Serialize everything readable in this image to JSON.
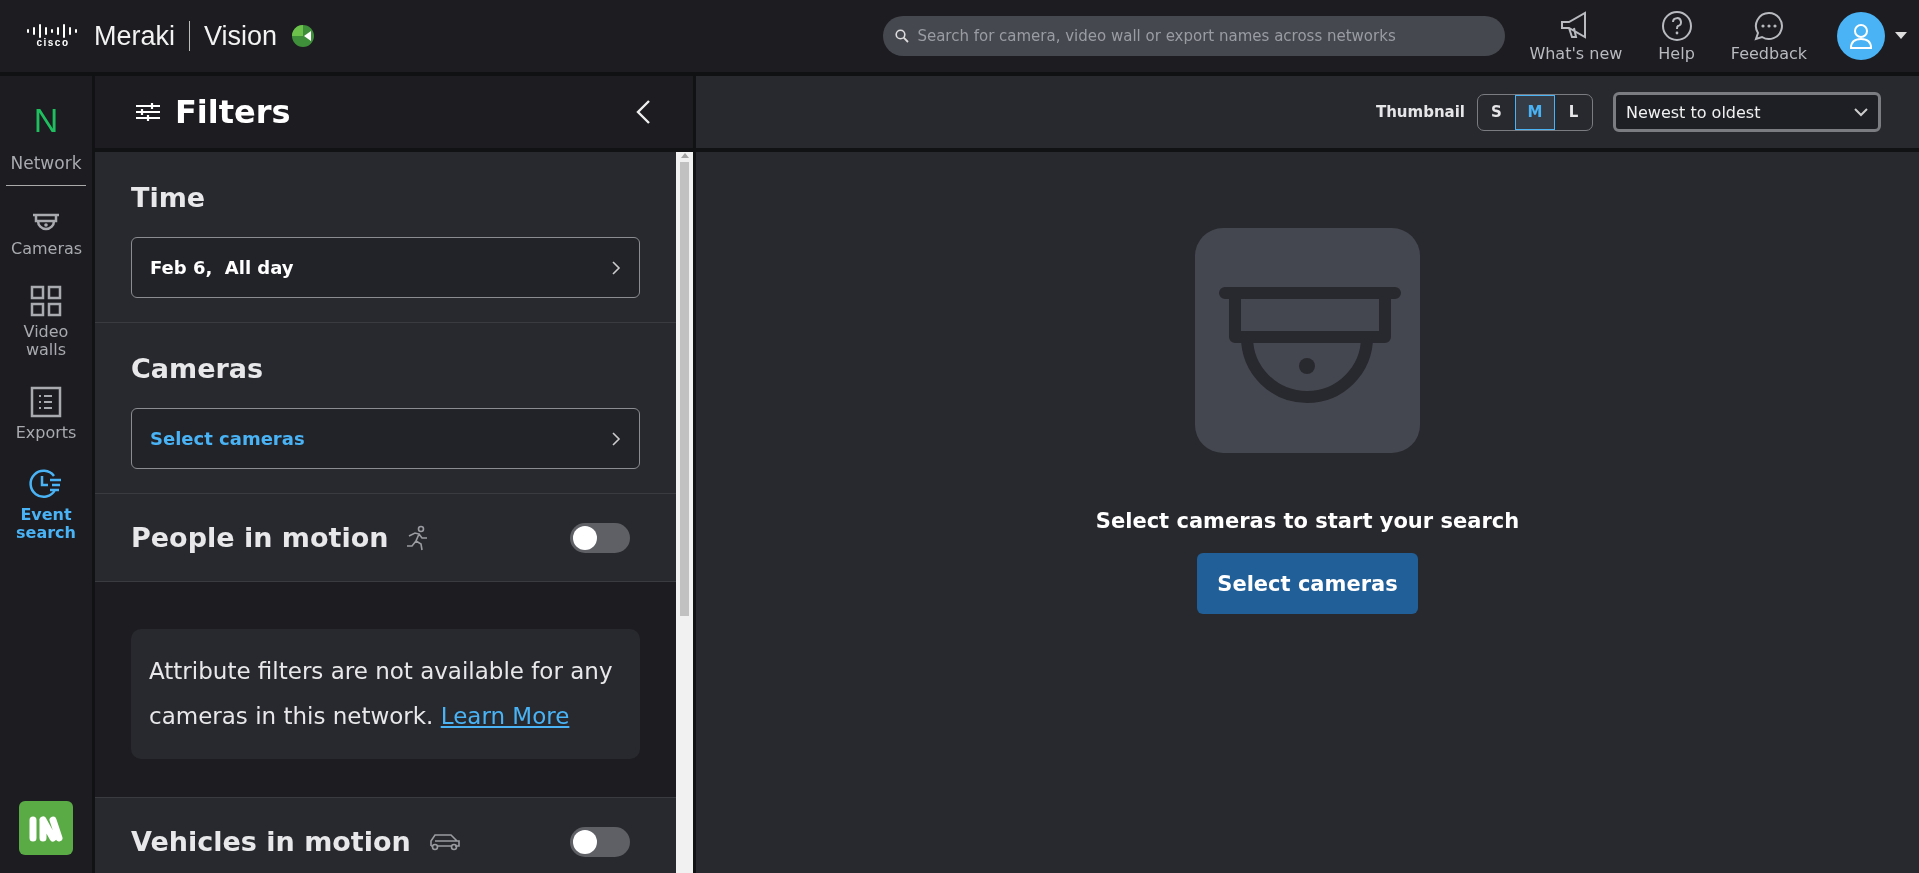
{
  "header": {
    "brand": "cisco",
    "product": "Meraki",
    "app": "Vision",
    "search": {
      "placeholder": "Search for camera, video wall or export names across networks"
    },
    "actions": [
      {
        "kind": "megaphone",
        "label": "What's new"
      },
      {
        "kind": "help",
        "label": "Help"
      },
      {
        "kind": "chat",
        "label": "Feedback"
      }
    ]
  },
  "nav": {
    "network": {
      "initial": "N",
      "label": "Network"
    },
    "items": [
      {
        "kind": "camera",
        "label": "Cameras",
        "selected": false
      },
      {
        "kind": "grid",
        "label": "Video walls",
        "selected": false
      },
      {
        "kind": "list",
        "label": "Exports",
        "selected": false
      },
      {
        "kind": "clock",
        "label": "Event search",
        "selected": true
      }
    ]
  },
  "filters": {
    "title": "Filters",
    "sections": [
      {
        "kind": "picker",
        "heading": "Time",
        "value": "Feb 6,  All day",
        "filled": true
      },
      {
        "kind": "picker",
        "heading": "Cameras",
        "value": "Select cameras",
        "filled": false
      },
      {
        "kind": "people",
        "heading": "People in motion",
        "on": false
      },
      {
        "kind": "notice",
        "text": "Attribute filters are not available for any cameras in this network.",
        "link": "Learn More"
      },
      {
        "kind": "vehicles",
        "heading": "Vehicles in motion",
        "on": false
      }
    ]
  },
  "toolbar": {
    "thumbnail_label": "Thumbnail",
    "sizes": [
      {
        "label": "S",
        "selected": false
      },
      {
        "label": "M",
        "selected": true
      },
      {
        "label": "L",
        "selected": false
      }
    ],
    "sort": {
      "value": "Newest to oldest"
    }
  },
  "empty": {
    "message": "Select cameras to start your search",
    "button": "Select cameras"
  }
}
